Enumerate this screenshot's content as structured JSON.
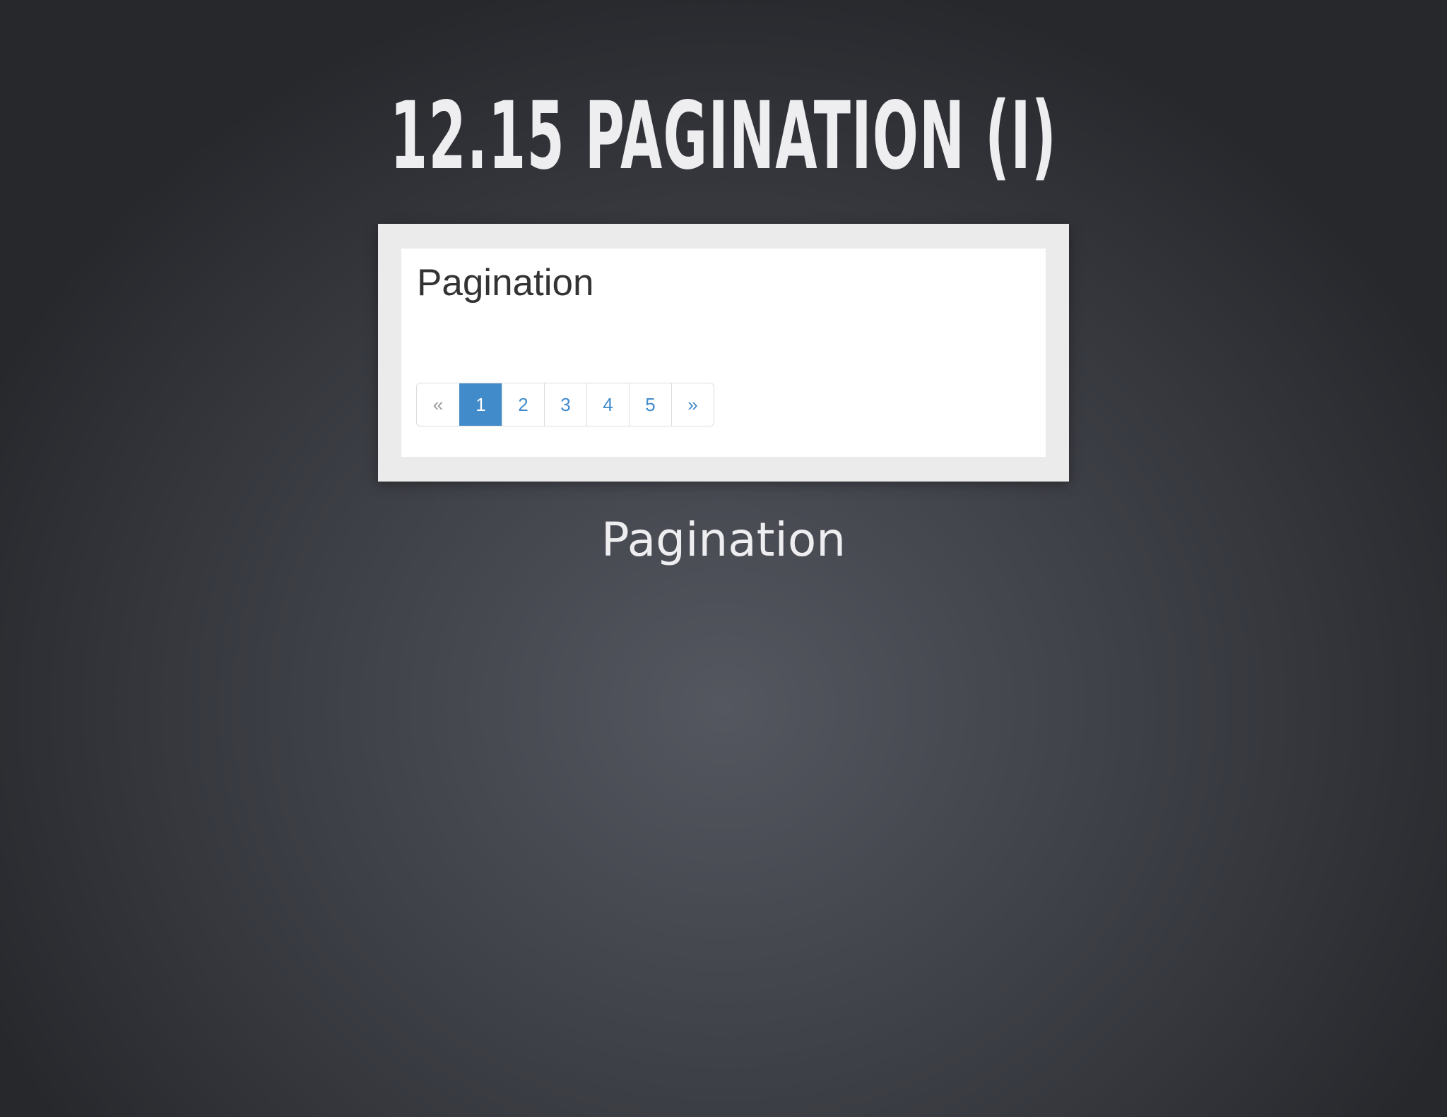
{
  "slide": {
    "title": "12.15 PAGINATION (I)",
    "caption": "Pagination"
  },
  "screenshot": {
    "heading": "Pagination",
    "pagination": {
      "prev_label": "«",
      "next_label": "»",
      "pages": [
        "1",
        "2",
        "3",
        "4",
        "5"
      ],
      "active_page": "1",
      "prev_disabled": true
    }
  },
  "colors": {
    "active": "#428bca",
    "link": "#428bca",
    "disabled": "#999999"
  }
}
